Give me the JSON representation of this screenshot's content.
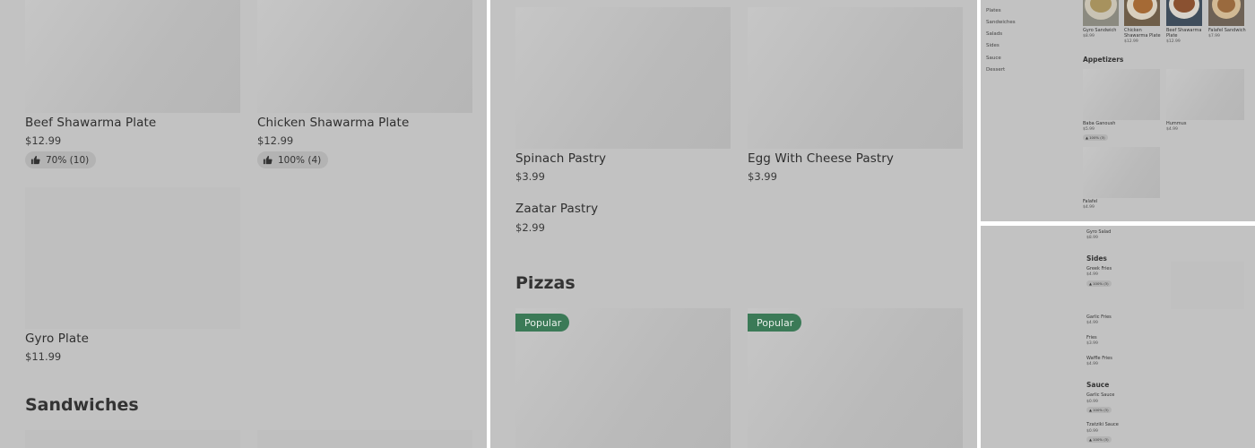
{
  "panel1": {
    "items": [
      {
        "name": "Beef Shawarma Plate",
        "price": "$12.99",
        "rating": "70% (10)"
      },
      {
        "name": "Chicken Shawarma Plate",
        "price": "$12.99",
        "rating": "100% (4)"
      },
      {
        "name": "Gyro Plate",
        "price": "$11.99"
      }
    ],
    "section": "Sandwiches"
  },
  "panel2": {
    "items": [
      {
        "name": "Spinach Pastry",
        "price": "$3.99"
      },
      {
        "name": "Egg With Cheese Pastry",
        "price": "$3.99"
      },
      {
        "name": "Zaatar Pastry",
        "price": "$2.99"
      }
    ],
    "section": "Pizzas",
    "badges": [
      "Popular",
      "Popular"
    ]
  },
  "panel3": {
    "nav": [
      "Plates",
      "Sandwiches",
      "Salads",
      "Sides",
      "Sauce",
      "Dessert"
    ],
    "top_items": [
      {
        "name": "Gyro Sandwich",
        "price": "$8.99"
      },
      {
        "name": "Chicken Shawarma Plate",
        "price": "$12.99"
      },
      {
        "name": "Beef Shawarma Plate",
        "price": "$12.99"
      },
      {
        "name": "Falafel Sandwich",
        "price": "$7.99"
      }
    ],
    "section": "Appetizers",
    "items": [
      {
        "name": "Baba Ganoush",
        "price": "$5.99",
        "rating": "100% (3)"
      },
      {
        "name": "Hummus",
        "price": "$4.99"
      },
      {
        "name": "Falafel",
        "price": "$4.99"
      }
    ]
  },
  "panel4": {
    "first": {
      "name": "Gyro Salad",
      "price": "$8.99"
    },
    "sides_section": "Sides",
    "sides": [
      {
        "name": "Greek Fries",
        "price": "$4.99",
        "rating": "100% (3)"
      },
      {
        "name": "Garlic Fries",
        "price": "$4.99"
      },
      {
        "name": "Fries",
        "price": "$3.99"
      },
      {
        "name": "Waffle Fries",
        "price": "$4.99"
      }
    ],
    "sauce_section": "Sauce",
    "sauces": [
      {
        "name": "Garlic Sauce",
        "price": "$0.99",
        "rating": "100% (3)"
      },
      {
        "name": "Tzatziki Sauce",
        "price": "$0.99",
        "rating": "100% (3)"
      }
    ]
  },
  "icons": {
    "rating": "thumbs-up-icon"
  }
}
